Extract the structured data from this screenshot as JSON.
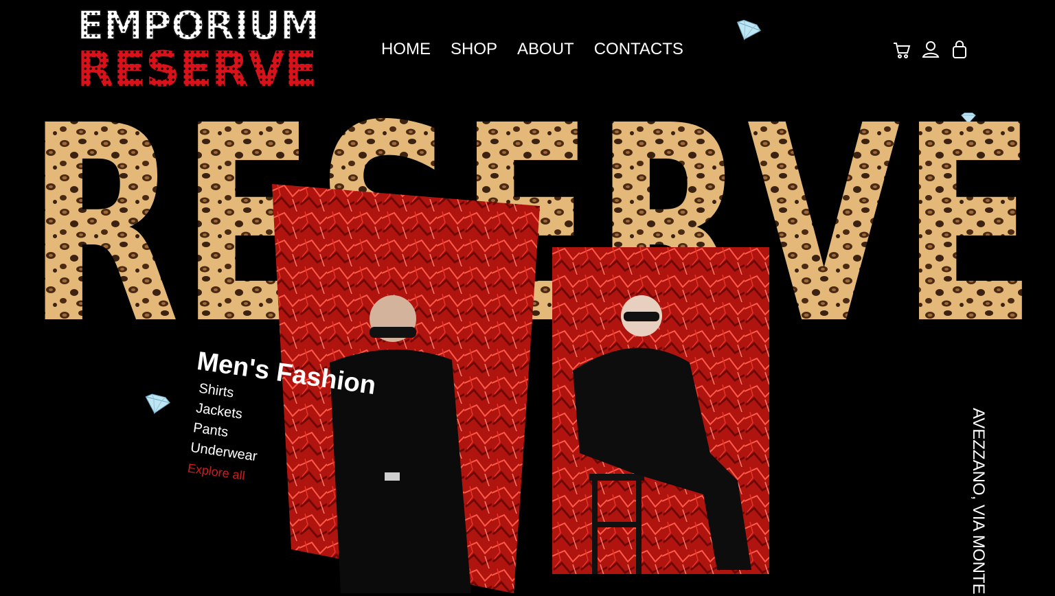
{
  "logo": {
    "line1": "EMPORIUM",
    "line2": "RESERVE"
  },
  "nav": {
    "items": [
      "HOME",
      "SHOP",
      "ABOUT",
      "CONTACTS"
    ]
  },
  "header_icons": [
    "cart-icon",
    "user-icon",
    "bag-icon"
  ],
  "hero": {
    "big_word": "RESERVE"
  },
  "category": {
    "title": "Men's Fashion",
    "items": [
      "Shirts",
      "Jackets",
      "Pants",
      "Underwear"
    ],
    "explore_label": "Explore all"
  },
  "address": "AVEZZANO, VIA MONTE",
  "colors": {
    "background": "#000000",
    "accent_red": "#d8111b",
    "leopard_base": "#e3b878",
    "leopard_spot": "#3b2211",
    "foil_red": "#b0140f"
  }
}
